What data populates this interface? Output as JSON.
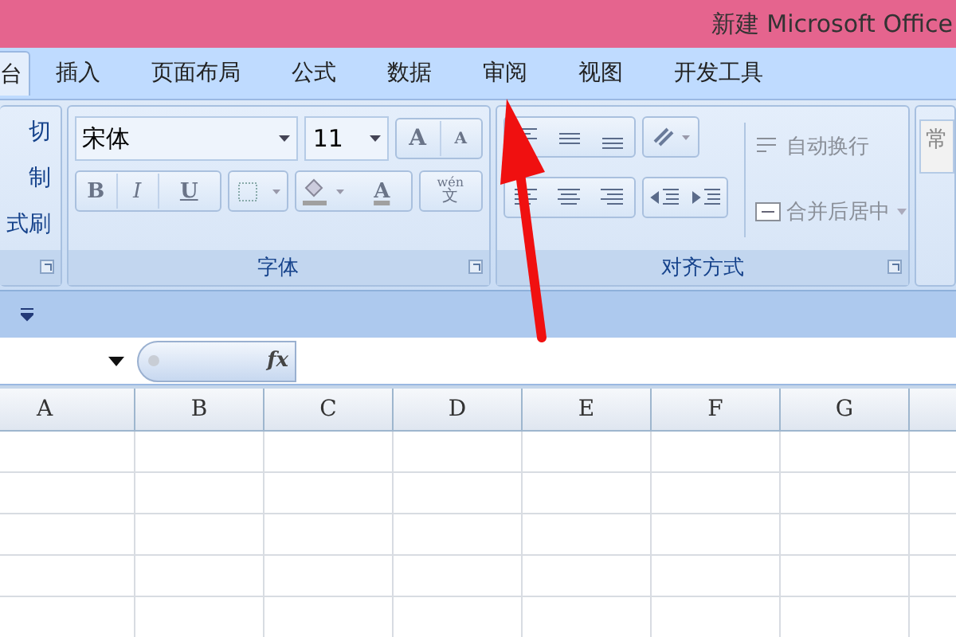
{
  "title_bar": {
    "title": "新建 Microsoft Office"
  },
  "tabs": [
    {
      "label": "台",
      "selected": true
    },
    {
      "label": "插入",
      "selected": false
    },
    {
      "label": "页面布局",
      "selected": false
    },
    {
      "label": "公式",
      "selected": false
    },
    {
      "label": "数据",
      "selected": false
    },
    {
      "label": "审阅",
      "selected": false
    },
    {
      "label": "视图",
      "selected": false
    },
    {
      "label": "开发工具",
      "selected": false
    }
  ],
  "clipboard": {
    "items": [
      "切",
      "制",
      "式刷"
    ]
  },
  "font_group": {
    "font_name": "宋体",
    "font_size": "11",
    "grow_label": "A",
    "shrink_label": "A",
    "styles": [
      "B",
      "I",
      "U"
    ],
    "font_color_label": "A",
    "phonetic": {
      "top": "wén",
      "bottom": "文"
    },
    "label": "字体"
  },
  "alignment_group": {
    "wrap_text": "自动换行",
    "merge_center": "合并后居中",
    "label": "对齐方式"
  },
  "number_group": {
    "format": "常"
  },
  "formula_bar": {
    "fx": "fx"
  },
  "columns": [
    "A",
    "B",
    "C",
    "D",
    "E",
    "F",
    "G"
  ]
}
